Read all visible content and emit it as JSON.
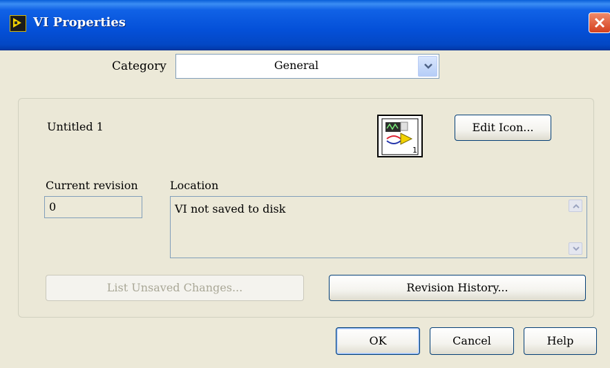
{
  "window": {
    "title": "VI Properties",
    "close_icon": "close-icon",
    "app_icon": "labview-vi-icon"
  },
  "category": {
    "label": "Category",
    "selected": "General"
  },
  "general": {
    "vi_name": "Untitled 1",
    "vi_icon_number": "1",
    "edit_icon_label": "Edit Icon...",
    "current_revision_label": "Current revision",
    "current_revision_value": "0",
    "location_label": "Location",
    "location_value": "VI not saved to disk",
    "list_unsaved_label": "List Unsaved Changes...",
    "revision_history_label": "Revision History..."
  },
  "footer": {
    "ok_label": "OK",
    "cancel_label": "Cancel",
    "help_label": "Help"
  },
  "colors": {
    "titlebar": "#0450d8",
    "dialog_bg": "#ece9d8",
    "close_button": "#e05a3d"
  }
}
